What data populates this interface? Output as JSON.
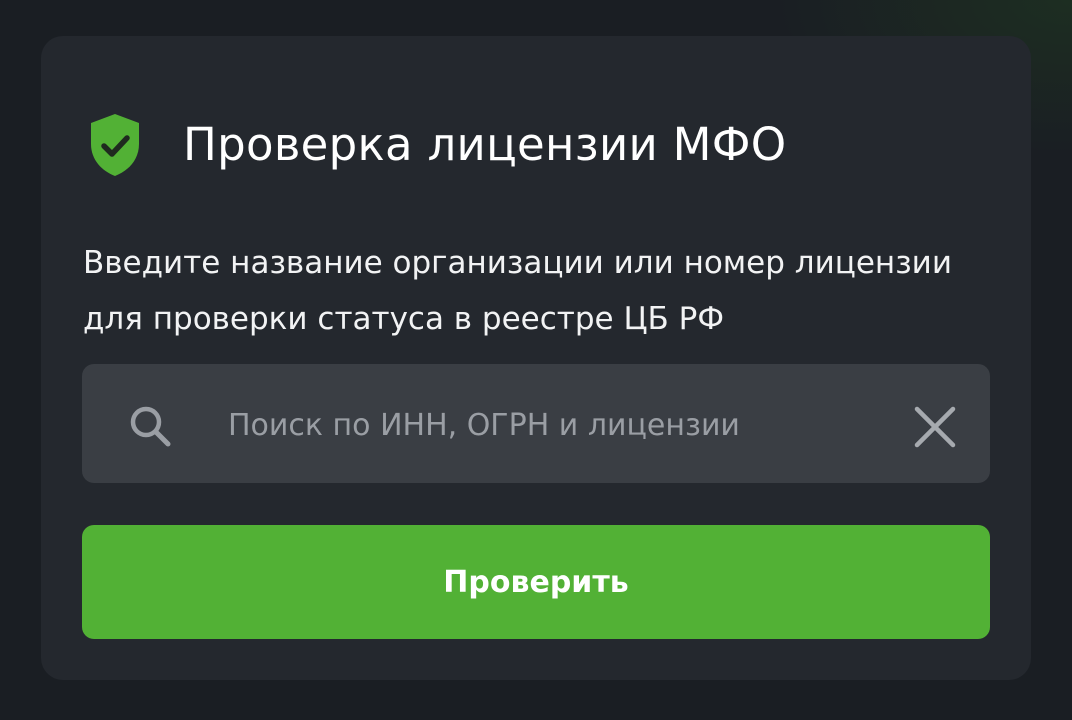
{
  "card": {
    "title": "Проверка лицензии МФО",
    "shield_icon": "shield-check-icon",
    "description": "Введите название организации или номер лицензии для проверки статуса в реестре ЦБ РФ"
  },
  "search": {
    "value": "",
    "placeholder": "Поиск по ИНН, ОГРН и лицензии",
    "search_icon": "search-icon",
    "clear_icon": "close-icon"
  },
  "actions": {
    "check_label": "Проверить"
  },
  "colors": {
    "accent": "#52b135",
    "card_background": "#24282e",
    "page_background": "#1a1e23",
    "input_background": "#3a3e44"
  }
}
